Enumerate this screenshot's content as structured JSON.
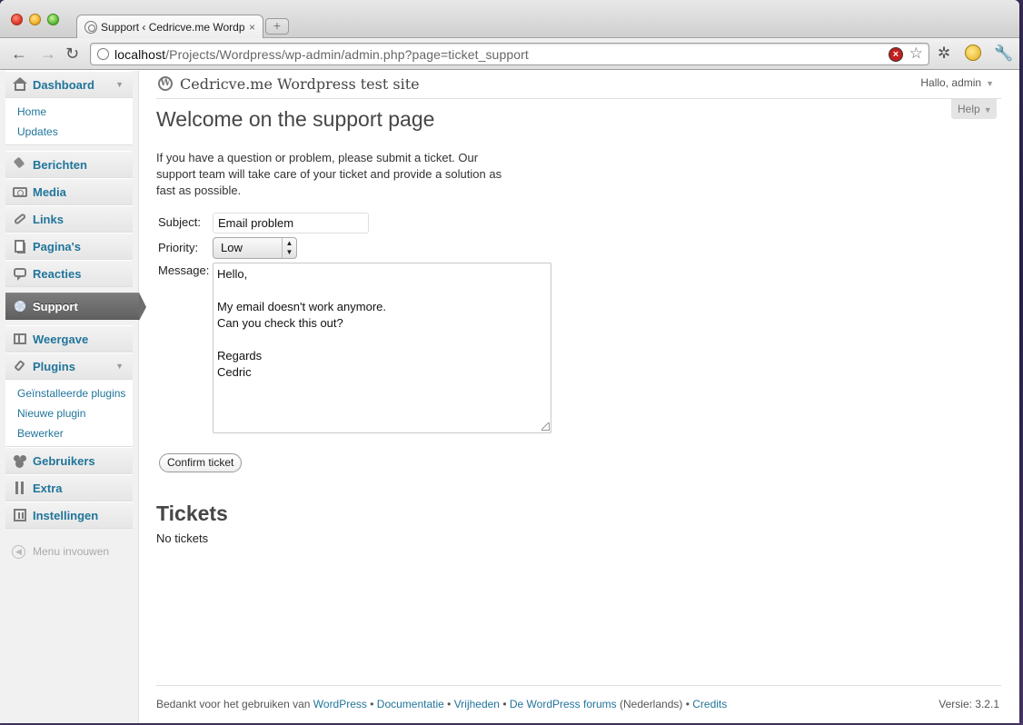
{
  "browser": {
    "tab_title": "Support ‹ Cedricve.me Wordp",
    "tab_close": "×",
    "new_tab": "+",
    "url_host": "localhost",
    "url_path": "/Projects/Wordpress/wp-admin/admin.php?page=ticket_support",
    "stop_glyph": "×",
    "star_glyph": "☆",
    "back_glyph": "←",
    "forward_glyph": "→",
    "reload_glyph": "↻",
    "wrench_glyph": "🔧",
    "bug_glyph": "✲"
  },
  "sidebar": {
    "dashboard": "Dashboard",
    "dashboard_sub": [
      "Home",
      "Updates"
    ],
    "berichten": "Berichten",
    "media": "Media",
    "links": "Links",
    "paginas": "Pagina's",
    "reacties": "Reacties",
    "support": "Support",
    "weergave": "Weergave",
    "plugins": "Plugins",
    "plugins_sub": [
      "Geïnstalleerde plugins",
      "Nieuwe plugin",
      "Bewerker"
    ],
    "gebruikers": "Gebruikers",
    "extra": "Extra",
    "instellingen": "Instellingen",
    "collapse": "Menu invouwen",
    "arrow": "▼",
    "collapse_glyph": "◀"
  },
  "header": {
    "site_title": "Cedricve.me Wordpress test site",
    "wp_logo_glyph": "W",
    "greeting": "Hallo, admin",
    "arrow": "▼",
    "help": "Help"
  },
  "main": {
    "heading": "Welcome on the support page",
    "intro": "If you have a question or problem, please submit a ticket. Our support team will take care of your ticket and provide a solution as fast as possible.",
    "subject_label": "Subject:",
    "subject_value": "Email problem",
    "priority_label": "Priority:",
    "priority_value": "Low",
    "priority_updown": "▲\n▼",
    "message_label": "Message:",
    "message_value": "Hello,\n\nMy email doesn't work anymore.\nCan you check this out?\n\nRegards\nCedric",
    "confirm_button": "Confirm ticket",
    "tickets_heading": "Tickets",
    "no_tickets": "No tickets"
  },
  "footer": {
    "prefix": "Bedankt voor het gebruiken van ",
    "link_wordpress": "WordPress",
    "sep": " • ",
    "link_docs": "Documentatie",
    "link_freedoms": "Vrijheden",
    "link_forums": "De WordPress forums",
    "nl": " (Nederlands)",
    "link_credits": "Credits",
    "version": "Versie: 3.2.1"
  },
  "colors": {
    "link": "#21759b",
    "current_menu": "#6d6d6d"
  }
}
